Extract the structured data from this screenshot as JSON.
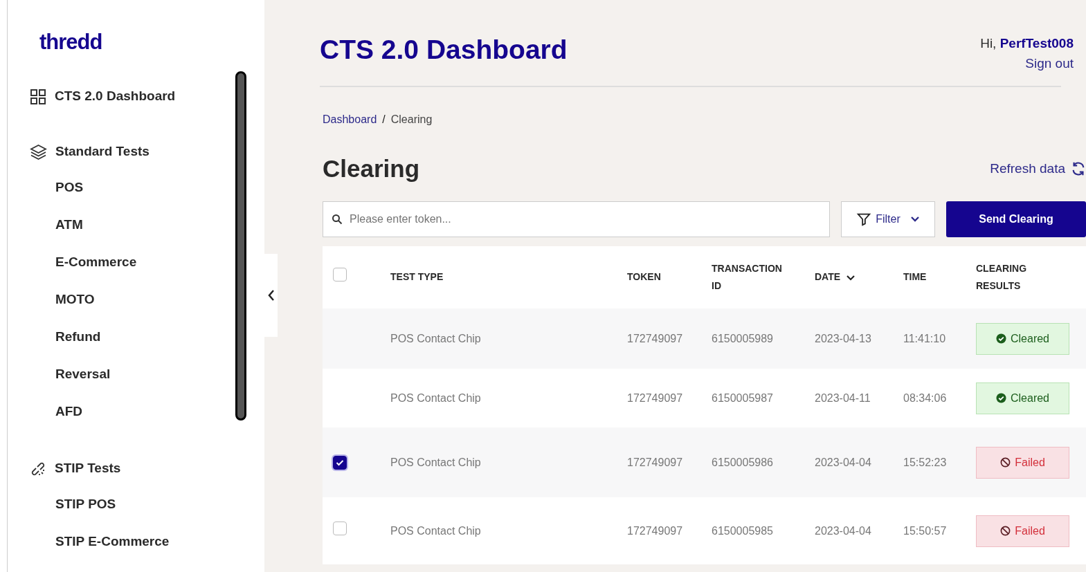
{
  "sidebar": {
    "logo": "thredd",
    "sections": [
      {
        "label": "CTS 2.0 Dashboard"
      },
      {
        "label": "Standard Tests",
        "children": [
          {
            "label": "POS"
          },
          {
            "label": "ATM"
          },
          {
            "label": "E-Commerce"
          },
          {
            "label": "MOTO"
          },
          {
            "label": "Refund"
          },
          {
            "label": "Reversal"
          },
          {
            "label": "AFD"
          }
        ]
      },
      {
        "label": "STIP Tests",
        "children": [
          {
            "label": "STIP POS"
          },
          {
            "label": "STIP E-Commerce"
          }
        ]
      }
    ]
  },
  "header": {
    "title": "CTS 2.0 Dashboard",
    "greeting": "Hi,",
    "user": "PerfTest008",
    "sign_out": "Sign out"
  },
  "breadcrumb_separator": "/",
  "breadcrumb": [
    {
      "label": "Dashboard",
      "selected": false
    },
    {
      "label": "Clearing",
      "selected": true
    }
  ],
  "page_title": "Clearing",
  "refresh": "Refresh data",
  "search": {
    "placeholder": "Please enter token..."
  },
  "filter": "Filter",
  "send_button": "Send Clearing",
  "table": {
    "select_all_checked": false,
    "columns": [
      {
        "label": "TEST TYPE",
        "sorted": false
      },
      {
        "label": "TOKEN",
        "sorted": false
      },
      {
        "label": "TRANSACTION ID",
        "sorted": false
      },
      {
        "label": "DATE",
        "sorted": true
      },
      {
        "label": "TIME",
        "sorted": false
      },
      {
        "label": "CLEARING RESULTS",
        "sorted": false
      }
    ],
    "rows": [
      {
        "test_type": "POS Contact Chip",
        "token": "172749097",
        "transaction_id": "6150005989",
        "date": "2023-04-13",
        "time": "11:41:10",
        "result": {
          "kind": "cleared",
          "label": "Cleared"
        }
      },
      {
        "test_type": "POS Contact Chip",
        "token": "172749097",
        "transaction_id": "6150005987",
        "date": "2023-04-11",
        "time": "08:34:06",
        "result": {
          "kind": "cleared",
          "label": "Cleared"
        }
      },
      {
        "checked": true,
        "test_type": "POS Contact Chip",
        "token": "172749097",
        "transaction_id": "6150005986",
        "date": "2023-04-04",
        "time": "15:52:23",
        "result": {
          "kind": "failed",
          "label": "Failed"
        }
      },
      {
        "checked": false,
        "test_type": "POS Contact Chip",
        "token": "172749097",
        "transaction_id": "6150005985",
        "date": "2023-04-04",
        "time": "15:50:57",
        "result": {
          "kind": "failed",
          "label": "Failed"
        }
      }
    ]
  }
}
